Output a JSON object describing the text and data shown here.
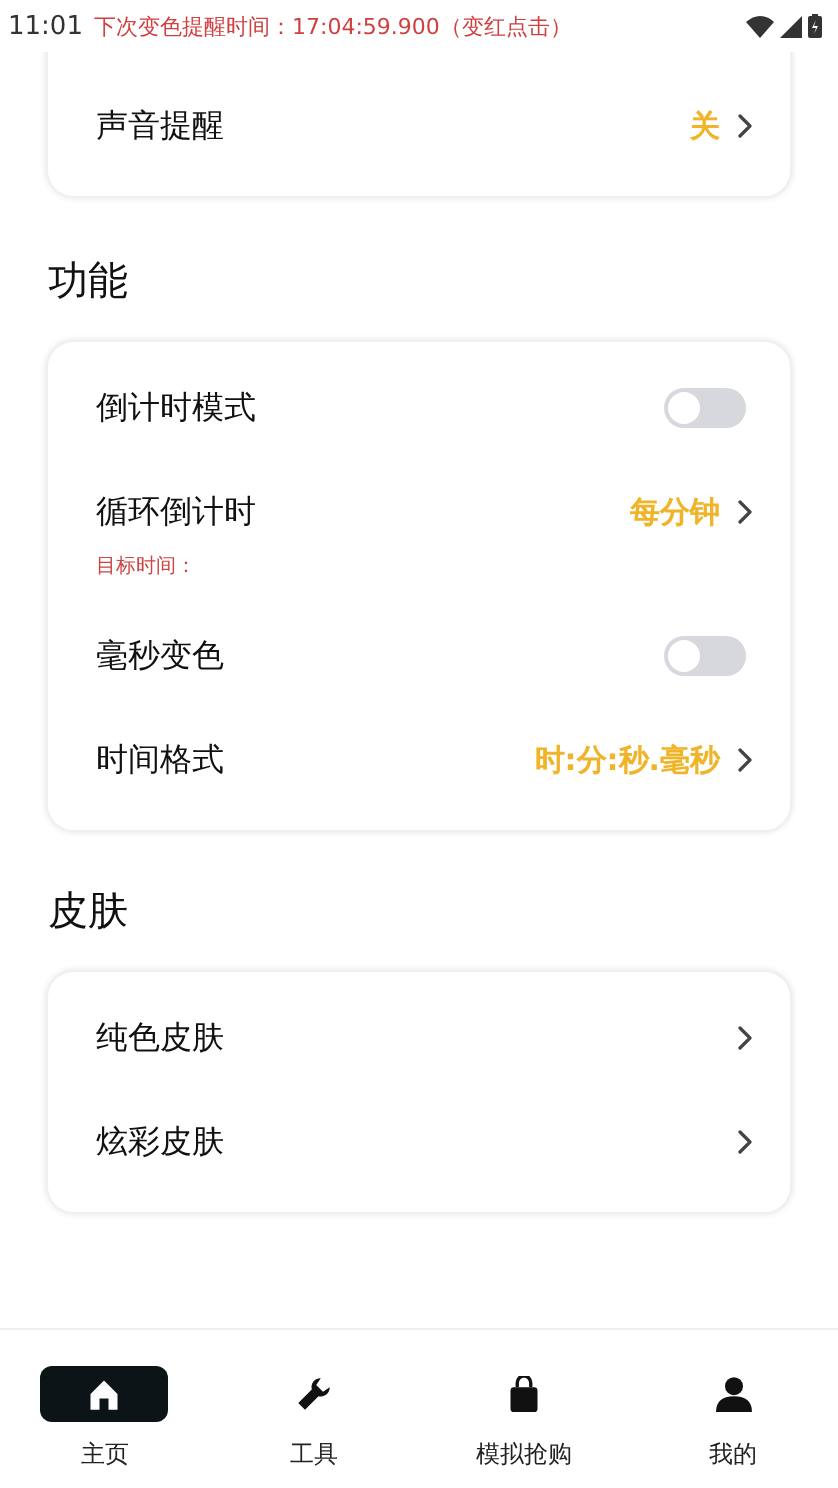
{
  "status_bar": {
    "time": "11:01",
    "overlay_text": "下次变色提醒时间：17:04:59.900（变红点击）"
  },
  "sections": [
    {
      "items": [
        {
          "kind": "nav",
          "label": "声音提醒",
          "value": "关"
        }
      ]
    },
    {
      "title": "功能",
      "items": [
        {
          "kind": "toggle",
          "label": "倒计时模式",
          "on": false
        },
        {
          "kind": "nav",
          "label": "循环倒计时",
          "value": "每分钟",
          "note": "目标时间："
        },
        {
          "kind": "toggle",
          "label": "毫秒变色",
          "on": false
        },
        {
          "kind": "nav",
          "label": "时间格式",
          "value": "时:分:秒.毫秒"
        }
      ]
    },
    {
      "title": "皮肤",
      "items": [
        {
          "kind": "nav",
          "label": "纯色皮肤"
        },
        {
          "kind": "nav",
          "label": "炫彩皮肤"
        }
      ]
    }
  ],
  "bottom_nav": [
    {
      "kind": "home",
      "label": "主页",
      "selected": true
    },
    {
      "kind": "tool",
      "label": "工具",
      "selected": false
    },
    {
      "kind": "bag",
      "label": "模拟抢购",
      "selected": false
    },
    {
      "kind": "person",
      "label": "我的",
      "selected": false
    }
  ]
}
